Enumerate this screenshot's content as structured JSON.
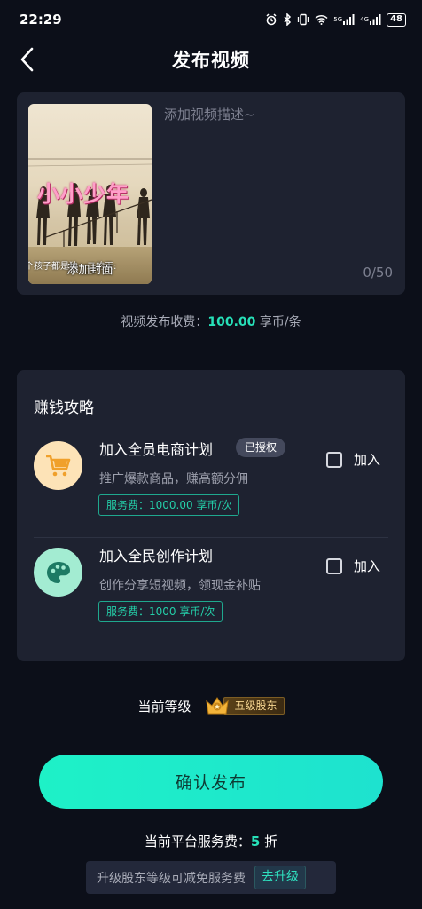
{
  "status": {
    "time": "22:29",
    "net1": "5G",
    "net2": "4G",
    "battery": "48",
    "icons": [
      "alarm-icon",
      "bluetooth-icon",
      "vibrate-icon",
      "wifi-icon",
      "signal-icon",
      "signal-icon",
      "battery-icon"
    ]
  },
  "header": {
    "title": "发布视频",
    "back_icon": "chevron-left-icon"
  },
  "editor": {
    "cover_title": "小小少年",
    "cover_subtitle": "个孩子都是独一二的天:",
    "cover_label": "添加封面",
    "placeholder": "添加视频描述~",
    "char_count": "0/50"
  },
  "fee": {
    "prefix": "视频发布收费：",
    "amount": "100.00",
    "suffix": "享币/条"
  },
  "earn": {
    "title": "赚钱攻略",
    "plans": [
      {
        "name": "加入全员电商计划",
        "badge": "已授权",
        "desc": "推广爆款商品，赚高额分佣",
        "fee": "服务费：1000.00 享币/次",
        "join": "加入",
        "icon": "shopping-cart-icon",
        "icon_bg": "#fde3b7",
        "icon_color": "#f0a02b"
      },
      {
        "name": "加入全民创作计划",
        "badge": "",
        "desc": "创作分享短视频，领现金补贴",
        "fee": "服务费：1000 享币/次",
        "join": "加入",
        "icon": "palette-icon",
        "icon_bg": "#a3ecd2",
        "icon_color": "#1d7a64"
      }
    ]
  },
  "level": {
    "label": "当前等级",
    "badge": "五级股东",
    "badge_icon": "crown-icon"
  },
  "confirm": {
    "label": "确认发布"
  },
  "service": {
    "prefix": "当前平台服务费：",
    "value": "5",
    "suffix": "折"
  },
  "upgrade": {
    "text": "升级股东等级可减免服务费",
    "button": "去升级"
  },
  "colors": {
    "background": "#0c0f19",
    "card": "#1e2230",
    "accent": "#27e0b8",
    "button": "#1ef1c7"
  }
}
